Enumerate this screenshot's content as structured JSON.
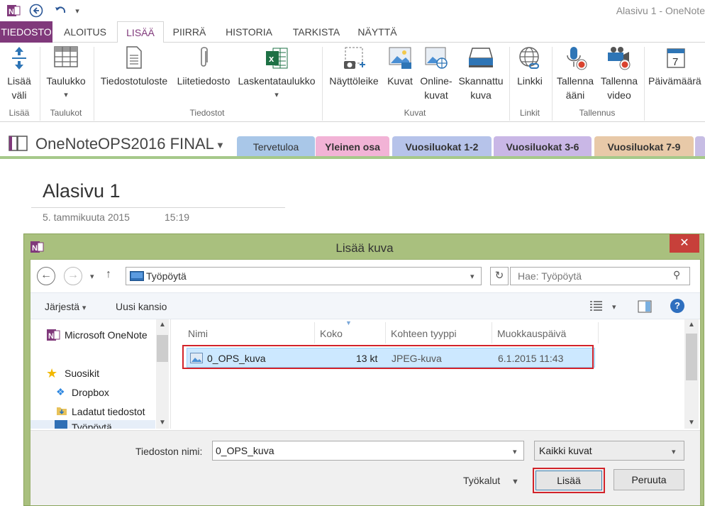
{
  "window": {
    "title": "Alasivu 1 - OneNote"
  },
  "ribbon_tabs": [
    {
      "label": "TIEDOSTO"
    },
    {
      "label": "ALOITUS"
    },
    {
      "label": "LISÄÄ"
    },
    {
      "label": "PIIRRÄ"
    },
    {
      "label": "HISTORIA"
    },
    {
      "label": "TARKISTA"
    },
    {
      "label": "NÄYTTÄ"
    }
  ],
  "ribbon": {
    "buttons": {
      "insert_space": [
        "Lisää",
        "väli"
      ],
      "table": "Taulukko",
      "printout": "Tiedostotuloste",
      "attachment": "Liitetiedosto",
      "spreadsheet": "Laskentataulukko",
      "screenshot": "Näyttöleike",
      "pictures": "Kuvat",
      "online_pictures": [
        "Online-",
        "kuvat"
      ],
      "scanned": [
        "Skannattu",
        "kuva"
      ],
      "link": "Linkki",
      "audio": [
        "Tallenna",
        "ääni"
      ],
      "video": [
        "Tallenna",
        "video"
      ],
      "date": "Päivämäärä"
    },
    "groups": {
      "insert": "Lisää",
      "tables": "Taulukot",
      "files": "Tiedostot",
      "images": "Kuvat",
      "links": "Linkit",
      "recording": "Tallennus"
    },
    "date_icon_number": "7"
  },
  "notebook": {
    "name": "OneNoteOPS2016 FINAL",
    "sections": [
      {
        "label": "Tervetuloa",
        "color": "#a9c7e8"
      },
      {
        "label": "Yleinen osa",
        "color": "#f2b3d6"
      },
      {
        "label": "Vuosiluokat 1-2",
        "color": "#b6c3ea"
      },
      {
        "label": "Vuosiluokat 3-6",
        "color": "#c9b7e6"
      },
      {
        "label": "Vuosiluokat 7-9",
        "color": "#e8c9a8"
      }
    ]
  },
  "page": {
    "title": "Alasivu 1",
    "date": "5. tammikuuta 2015",
    "time": "15:19"
  },
  "dialog": {
    "title": "Lisää kuva",
    "close_glyph": "✕",
    "address": "Työpöytä",
    "search_placeholder": "Hae: Työpöytä",
    "organize": "Järjestä",
    "new_folder": "Uusi kansio",
    "nav_items": [
      {
        "label": "Microsoft OneNote"
      },
      {
        "label": "Suosikit"
      },
      {
        "label": "Dropbox"
      },
      {
        "label": "Ladatut tiedostot"
      },
      {
        "label": "Työpöytä"
      }
    ],
    "columns": {
      "name": "Nimi",
      "size": "Koko",
      "type": "Kohteen tyyppi",
      "modified": "Muokkauspäivä"
    },
    "files": [
      {
        "name": "0_OPS_kuva",
        "size": "13 kt",
        "type": "JPEG-kuva",
        "modified": "6.1.2015 11:43"
      }
    ],
    "filename_label": "Tiedoston nimi:",
    "filename_value": "0_OPS_kuva",
    "filter": "Kaikki kuvat",
    "tools": "Työkalut",
    "insert_button": "Lisää",
    "cancel_button": "Peruuta"
  }
}
